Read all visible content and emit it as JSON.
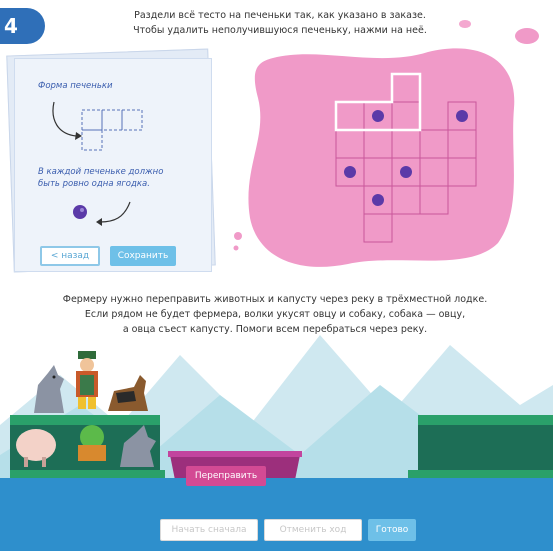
{
  "badge": "4",
  "top": {
    "instruction_line1": "Раздели всё тесто на печеньки так, как указано в заказе.",
    "instruction_line2": "Чтобы удалить неполучившуюся печеньку, нажми на неё.",
    "shape_label": "Форма печеньки",
    "berry_label": "В каждой печеньке должно быть ровно одна ягодка.",
    "back_button": "< назад",
    "save_button": "Сохранить"
  },
  "bottom": {
    "instruction_line1": "Фермеру нужно переправить животных и капусту через реку в трёхместной лодке.",
    "instruction_line2": "Если рядом не будет фермера, волки укусят овцу и собаку, собака — овцу,",
    "instruction_line3": "а овца съест капусту. Помоги всем перебраться через реку.",
    "ferry_button": "Переправить",
    "restart_button": "Начать сначала",
    "undo_button": "Отменить ход",
    "done_button": "Готово"
  },
  "colors": {
    "badge": "#2f6fb8",
    "dough": "#f09ac8",
    "berry": "#5b3aa8",
    "water": "#2e8fcc",
    "accent": "#6ec0e8",
    "boat": "#9c2f7c"
  }
}
